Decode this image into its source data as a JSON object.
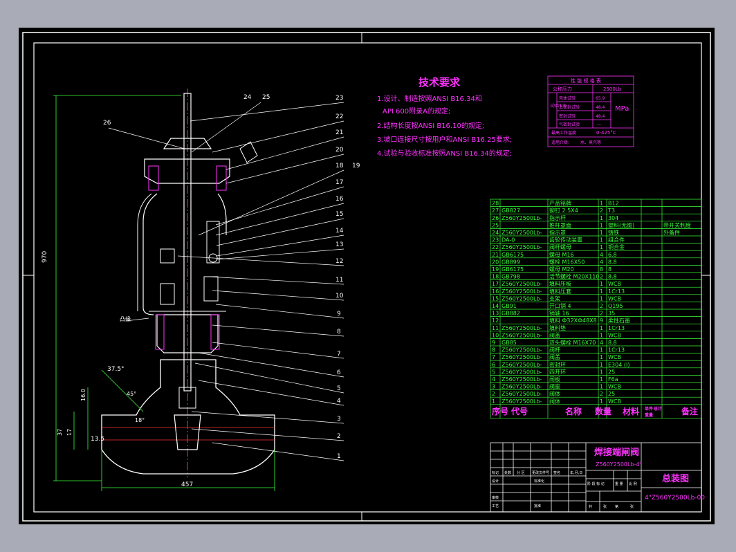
{
  "tech": {
    "title": "技术要求",
    "lines": [
      "1.设计、制造按照ANSI B16.34和",
      "API 600附录A的规定;",
      "2.结构长度按ANSI B16.10的规定;",
      "3.坡口连接尺寸按用户和ANSI B16.25要求;",
      "4.试验与验收标准按照ANSI B16.34的规定;"
    ]
  },
  "perf": {
    "title": "性 能 规 格 表",
    "nominal_label": "公称压力",
    "nominal_value": "2500Lb",
    "test_label": "试验压力",
    "tests": [
      {
        "name": "壳体试验",
        "value": "65.9"
      },
      {
        "name": "上密封试验",
        "value": "48.4"
      },
      {
        "name": "密封试验",
        "value": "48.4"
      },
      {
        "name": "气密封试验",
        "value": "---"
      }
    ],
    "unit": "MPa",
    "temp_label": "最高工作温度",
    "temp_value": "0-425°C",
    "medium_label": "适用介质:",
    "medium_value": "水、蒸汽等"
  },
  "bom": {
    "rows": [
      [
        "28",
        "",
        "产品铭牌",
        "1",
        "B12",
        ""
      ],
      [
        "27",
        "GB827",
        "铆钉 2.5X4",
        "2",
        "T3",
        ""
      ],
      [
        "26",
        "Z560Y2500Lb-",
        "指示杆",
        "1",
        "304",
        ""
      ],
      [
        "25",
        "",
        "推杆罩面",
        "1",
        "塑料(无图)",
        "带开关制度"
      ],
      [
        "24",
        "Z560Y2500Lb-",
        "指示罩",
        "1",
        "铸铁",
        "外备件"
      ],
      [
        "23",
        "DA-0",
        "齿轮传动装置",
        "1",
        "组合件",
        ""
      ],
      [
        "22",
        "Z560Y2500Lb-",
        "阀杆螺母",
        "1",
        "铜合金",
        ""
      ],
      [
        "21",
        "GB6175",
        "螺母 M16",
        "4",
        "6.8",
        ""
      ],
      [
        "20",
        "GB899",
        "螺栓 M16X50",
        "4",
        "8.8",
        ""
      ],
      [
        "19",
        "GB6175",
        "螺母 M20",
        "8",
        "8",
        ""
      ],
      [
        "18",
        "GB798",
        "活节螺栓 M20X110",
        "2",
        "8.8",
        ""
      ],
      [
        "17",
        "Z560Y2500Lb-",
        "填料压板",
        "1",
        "WCB",
        ""
      ],
      [
        "16",
        "Z560Y2500Lb-",
        "填料压套",
        "1",
        "1Cr13",
        ""
      ],
      [
        "15",
        "Z560Y2500Lb-",
        "支架",
        "1",
        "WCB",
        ""
      ],
      [
        "14",
        "GB91",
        "开口销 4",
        "2",
        "Q195",
        ""
      ],
      [
        "13",
        "GB882",
        "销轴 16",
        "2",
        "35",
        ""
      ],
      [
        "12",
        "",
        "填料 Ф32XФ48X8",
        "9",
        "柔性石墨",
        ""
      ],
      [
        "11",
        "Z560Y2500Lb-",
        "填料垫",
        "1",
        "1Cr13",
        ""
      ],
      [
        "10",
        "Z560Y2500Lb-",
        "阀盖",
        "1",
        "WCB",
        ""
      ],
      [
        "9",
        "GB85",
        "双头螺栓 M16X70",
        "4",
        "8.8",
        ""
      ],
      [
        "8",
        "Z560Y2500Lb-",
        "阀杆",
        "1",
        "1Cr13",
        ""
      ],
      [
        "7",
        "Z560Y2500Lb-",
        "阀盖",
        "1",
        "WCB",
        ""
      ],
      [
        "6",
        "Z560Y2500Lb-",
        "密封环",
        "1",
        "E304 (I)",
        ""
      ],
      [
        "5",
        "Z560Y2500Lb-",
        "四开环",
        "1",
        "25",
        ""
      ],
      [
        "4",
        "Z560Y2500Lb-",
        "闸板",
        "1",
        "F6a",
        ""
      ],
      [
        "3",
        "Z560Y2500Lb-",
        "阀座",
        "1",
        "WCB",
        ""
      ],
      [
        "2",
        "Z560Y2500Lb-",
        "阀体",
        "2",
        "25",
        ""
      ],
      [
        "1",
        "Z560Y2500Lb-",
        "阀体",
        "1",
        "WCB",
        ""
      ]
    ],
    "header": [
      "序号",
      "代号",
      "名称",
      "数量",
      "材料",
      "单件",
      "总计",
      "重量",
      "备注"
    ]
  },
  "titleblock": {
    "product_name": "焊接端闸阀",
    "model": "Z560Y2500Lb-4\"",
    "drawing_title": "总装图",
    "drawing_no": "4\"Z560Y2500Lb-00",
    "labels_row1": [
      "标记",
      "处数",
      "分 区",
      "更改文件号",
      "签名",
      "年,月,日"
    ],
    "labels_row2": [
      "设计",
      "",
      "标准化"
    ],
    "labels_row3": [
      "审核"
    ],
    "labels_row4": [
      "工艺",
      "",
      "批准"
    ],
    "stage_labels": [
      "阶 段 标 记",
      "重 量",
      "比 例"
    ],
    "sheet_labels": [
      "共",
      "张",
      "第",
      "张"
    ]
  },
  "balloons": [
    "24",
    "25",
    "26",
    "23",
    "22",
    "21",
    "20",
    "18",
    "19",
    "17",
    "16",
    "15",
    "14",
    "13",
    "12",
    "11",
    "10",
    "9",
    "8",
    "7",
    "6",
    "5",
    "4",
    "3",
    "2",
    "1"
  ],
  "dims": {
    "height": "970",
    "width": "457",
    "angle1": "37.5°",
    "angle2": "45°",
    "angle3": "18°",
    "d1": "16.0",
    "d2": "17",
    "d3": "13.5",
    "d4": "37",
    "note": "凸缘"
  }
}
